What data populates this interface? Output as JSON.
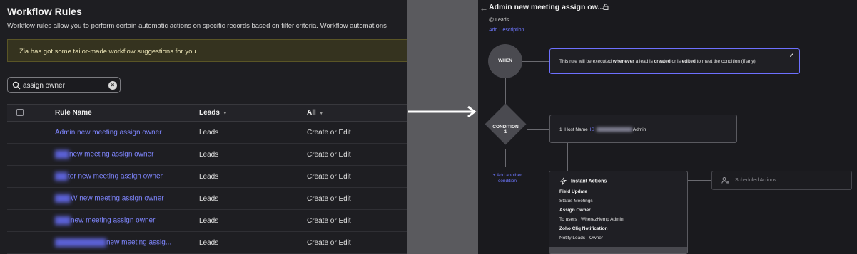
{
  "list_page": {
    "title": "Workflow Rules",
    "description": "Workflow rules allow you to perform certain automatic actions on specific records based on filter criteria. Workflow automations",
    "zia_banner": "Zia has got some tailor-made workflow suggestions for you.",
    "search": {
      "value": "assign owner",
      "icon": "search-icon",
      "clear_icon": "close-icon"
    },
    "columns": {
      "name": "Rule Name",
      "module": "Leads",
      "trigger": "All"
    },
    "rows": [
      {
        "name_suffix": "Admin new meeting assign owner",
        "module": "Leads",
        "trigger": "Create or Edit"
      },
      {
        "name_suffix": "new meeting assign owner",
        "module": "Leads",
        "trigger": "Create or Edit"
      },
      {
        "name_suffix": "ter new meeting assign owner",
        "module": "Leads",
        "trigger": "Create or Edit"
      },
      {
        "name_suffix": "W new meeting assign owner",
        "module": "Leads",
        "trigger": "Create or Edit"
      },
      {
        "name_suffix": "new meeting assign owner",
        "module": "Leads",
        "trigger": "Create or Edit"
      },
      {
        "name_suffix": "new meeting assig...",
        "module": "Leads",
        "trigger": "Create or Edit"
      }
    ]
  },
  "detail_page": {
    "back_icon": "arrow-left-icon",
    "title": "Admin new meeting assign ow...",
    "lock_icon": "lock-icon",
    "module": "@ Leads",
    "add_description": "Add Description",
    "when": {
      "label": "WHEN",
      "text_1": "This rule will be executed ",
      "text_2": "whenever",
      "text_3": " a lead is ",
      "text_4": "created",
      "text_5": " or is ",
      "text_6": "edited",
      "text_7": " to meet the condition (if any).",
      "edit_icon": "pencil-icon"
    },
    "condition": {
      "label_1": "CONDITION",
      "label_2": "1",
      "index": "1",
      "field": "Host Name",
      "operator": "IS",
      "value_suffix": "Admin"
    },
    "add_condition": "+ Add another condition",
    "instant_actions": {
      "title": "Instant Actions",
      "icon": "lightning-icon",
      "lines": [
        "Field Update",
        "Status Meetings",
        "Assign Owner",
        "To users : WherezHemp Admin",
        "Zoho Cliq Notification",
        "Notify Leads - Owner"
      ]
    },
    "scheduled_actions": {
      "title": "Scheduled Actions",
      "icon": "clock-user-icon"
    }
  },
  "colors": {
    "accent": "#6e77ff",
    "banner_bg": "#35331f",
    "link": "#7f86ff"
  }
}
